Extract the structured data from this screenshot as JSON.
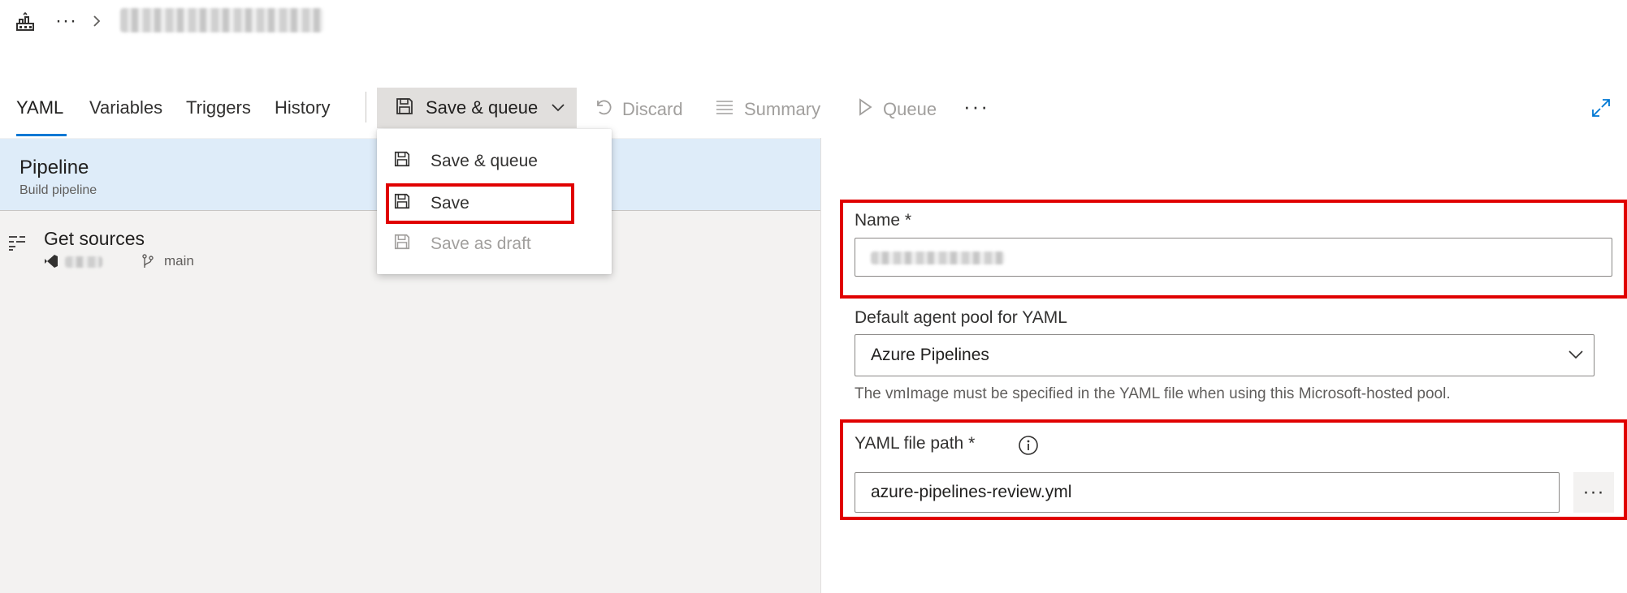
{
  "breadcrumb": {
    "project_icon": "build-pipeline-icon",
    "ellipsis": "···",
    "chevron_icon": "chevron-right-icon"
  },
  "tabs": [
    {
      "label": "YAML",
      "selected": true
    },
    {
      "label": "Variables"
    },
    {
      "label": "Triggers"
    },
    {
      "label": "History"
    }
  ],
  "toolbar": {
    "save_queue_label": "Save & queue",
    "discard_label": "Discard",
    "summary_label": "Summary",
    "queue_label": "Queue",
    "more_label": "···",
    "expand_icon": "expand-icon"
  },
  "dropdown": {
    "items": [
      {
        "label": "Save & queue",
        "icon": "save-icon",
        "enabled": true
      },
      {
        "label": "Save",
        "icon": "save-icon",
        "enabled": true,
        "highlighted": true
      },
      {
        "label": "Save as draft",
        "icon": "save-icon",
        "enabled": false
      }
    ]
  },
  "left": {
    "pipeline_title": "Pipeline",
    "pipeline_subtitle": "Build pipeline",
    "get_sources_title": "Get sources",
    "branch": "main"
  },
  "form": {
    "name_label": "Name *",
    "pool_label": "Default agent pool for YAML",
    "pool_value": "Azure Pipelines",
    "pool_hint": "The vmImage must be specified in the YAML file when using this Microsoft-hosted pool.",
    "yaml_label": "YAML file path *",
    "yaml_value": "azure-pipelines-review.yml",
    "browse_label": "···"
  },
  "colors": {
    "accent": "#0078d4",
    "highlight": "#e00000",
    "selected_row": "#deecf9",
    "panel_bg": "#f3f2f1"
  }
}
